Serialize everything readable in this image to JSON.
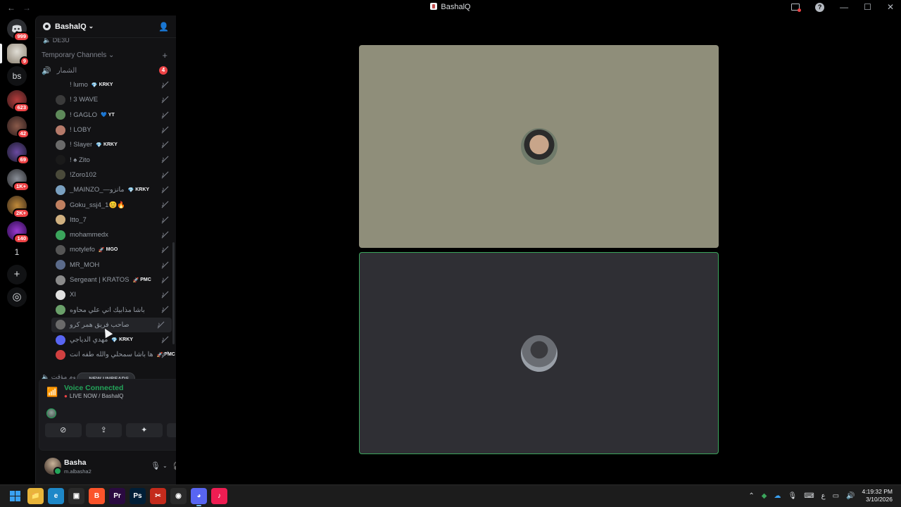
{
  "window": {
    "title": "BashalQ",
    "back_icon": "←",
    "forward_icon": "→",
    "controls": [
      "—",
      "☐",
      "✕"
    ]
  },
  "server_rail": {
    "servers": [
      {
        "badge": "999",
        "color": "#5865f2"
      },
      {
        "badge": "9",
        "color": "#c7c3b8",
        "selected": true
      },
      {
        "text": "bs"
      },
      {
        "badge": "623",
        "color": "#b43d3d"
      },
      {
        "badge": "42",
        "color": "#7a3a3a"
      },
      {
        "badge": "69",
        "color": "#4a3a8a"
      },
      {
        "badge": "1K+",
        "color": "#555a63"
      },
      {
        "badge": "2K+",
        "color": "#a06a2a"
      },
      {
        "badge": "140",
        "color": "#6a2aa0"
      },
      {
        "text": "1"
      }
    ],
    "add_server_icon": "+",
    "discover_icon": "◎"
  },
  "sidebar": {
    "server_name": "BashalQ",
    "prev_channel": "DE3U",
    "category": "Temporary Channels",
    "voice_channel": {
      "name": "الشمار",
      "count": "4"
    },
    "users": [
      {
        "name": "! lumo",
        "tag": "KRKY",
        "gem": "💎",
        "color": "transparent"
      },
      {
        "name": "! 3 WAVE",
        "tag": "",
        "color": "#3a3a3a"
      },
      {
        "name": "! GAGLO",
        "tag": "YT",
        "gem": "💙",
        "color": "#5e8a5a"
      },
      {
        "name": "! LOBY",
        "tag": "",
        "color": "#b57a6a"
      },
      {
        "name": "! Slayer",
        "tag": "KRKY",
        "gem": "💎",
        "color": "#6a6a6a"
      },
      {
        "name": "! ♠ Zito",
        "tag": "",
        "color": "#1a1a1a"
      },
      {
        "name": "!Zoro102",
        "tag": "",
        "color": "#4a4a3a"
      },
      {
        "name": "_MAINZO_—مانزو",
        "tag": "KRKY",
        "gem": "💎",
        "color": "#7aa0c0"
      },
      {
        "name": "Goku_ssj4_1😊🔥",
        "tag": "",
        "color": "#c08060"
      },
      {
        "name": "Itto_7",
        "tag": "",
        "color": "#d0b080"
      },
      {
        "name": "mohammedx",
        "tag": "",
        "color": "#3ba55c"
      },
      {
        "name": "motylefo",
        "tag": "MGO",
        "gem": "🚀",
        "color": "#555"
      },
      {
        "name": "MR_MOH",
        "tag": "",
        "color": "#5a6a8a"
      },
      {
        "name": "Sergeant | KRATOS",
        "tag": "PMC",
        "gem": "🚀",
        "color": "#8a8a8a"
      },
      {
        "name": "XI",
        "tag": "",
        "color": "#e0e0e0"
      },
      {
        "name": "باشا مذابيك اني علي محاوه",
        "tag": "",
        "color": "#6aa06a"
      },
      {
        "name": "صاحب فريق همر كرو",
        "tag": "",
        "color": "#6a6a6a",
        "hover": true
      },
      {
        "name": "مهدي الدياجي",
        "tag": "KRKY",
        "gem": "💎",
        "color": "#5865f2"
      },
      {
        "name": "ها باشا سمحلي والله طفه انت",
        "tag": "PMC",
        "gem": "🚀",
        "color": "#d04040"
      }
    ],
    "next_channel": "روم مؤقت",
    "new_unreads": "NEW UNREADS"
  },
  "voice_panel": {
    "status": "Voice Connected",
    "sub": "LIVE NOW / BashalQ",
    "buttons": [
      "camera-off",
      "share-screen",
      "activities",
      "soundboard"
    ]
  },
  "user_panel": {
    "name": "Basha",
    "sub": "m.albasha2"
  },
  "taskbar": {
    "apps": [
      {
        "name": "windows",
        "label": ""
      },
      {
        "name": "file-explorer",
        "label": "📁",
        "color": "#e8b43a"
      },
      {
        "name": "edge",
        "label": "e",
        "color": "#1e88c8"
      },
      {
        "name": "store",
        "label": "▣",
        "color": "#2a2a2a"
      },
      {
        "name": "brave",
        "label": "B",
        "color": "#fb542b"
      },
      {
        "name": "premiere",
        "label": "Pr",
        "color": "#2a0a40"
      },
      {
        "name": "photoshop",
        "label": "Ps",
        "color": "#001e36"
      },
      {
        "name": "snip",
        "label": "✂",
        "color": "#c42b1c"
      },
      {
        "name": "steam-like",
        "label": "◉",
        "color": "#2a2a2a"
      },
      {
        "name": "discord",
        "label": "◕",
        "color": "#5865f2",
        "active": true
      },
      {
        "name": "tiktok",
        "label": "♪",
        "color": "#ee1d52"
      }
    ],
    "lang": "ع",
    "time": "4:19:32 PM",
    "date": "3/10/2026"
  }
}
